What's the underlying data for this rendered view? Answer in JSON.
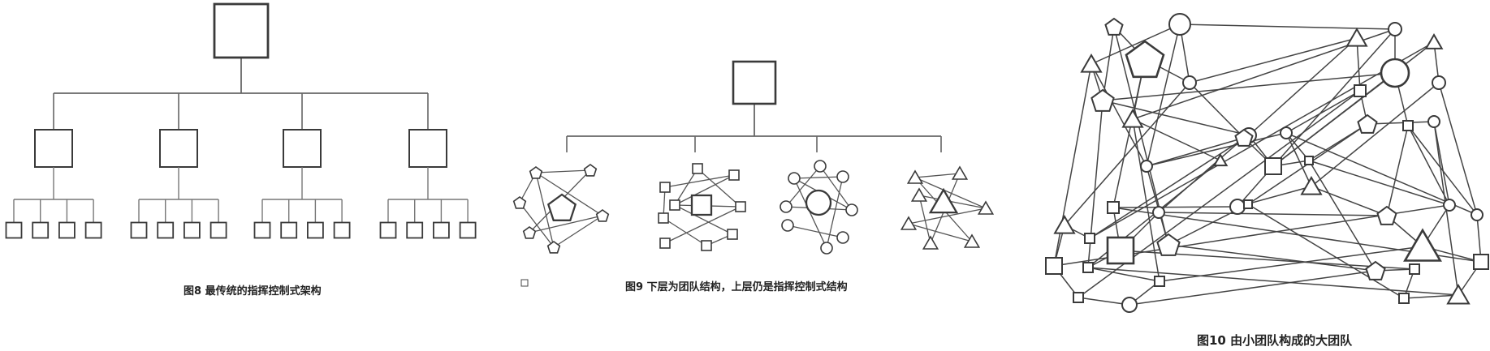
{
  "figures": [
    {
      "id": "fig8",
      "caption": "图8 最传统的指挥控制式架构"
    },
    {
      "id": "fig9",
      "caption": "图9 下层为团队结构，上层仍是指挥控制式结构"
    },
    {
      "id": "fig10",
      "caption": "图10 由小团队构成的大团队"
    }
  ],
  "colors": {
    "stroke": "#3a3a3a",
    "connector": "#777777",
    "caption": "#222222",
    "background": "#ffffff"
  },
  "fig8_tree": {
    "root": "square",
    "branches": 4,
    "branch_node": "square",
    "leaves_per_branch": 4,
    "leaf_node": "square"
  },
  "fig9_tree": {
    "root": "square",
    "teams": [
      "pentagon",
      "square",
      "circle",
      "triangle"
    ]
  },
  "fig10_network": {
    "node_shapes": [
      "pentagon",
      "square",
      "circle",
      "triangle"
    ]
  }
}
